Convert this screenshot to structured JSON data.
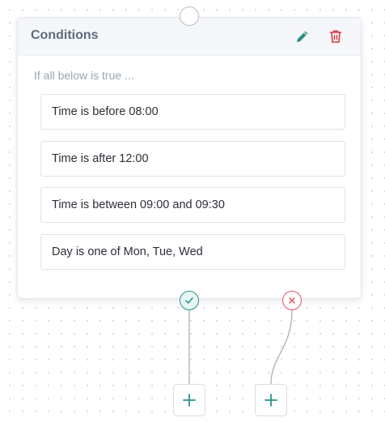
{
  "card": {
    "title": "Conditions",
    "subtitle": "If all below is true ...",
    "actions": [
      {
        "name": "edit",
        "icon": "pencil-icon",
        "color": "#2a8f88"
      },
      {
        "name": "delete",
        "icon": "trash-icon",
        "color": "#dc3545"
      }
    ],
    "conditions": [
      {
        "label": "Time is before 08:00"
      },
      {
        "label": "Time is after 12:00"
      },
      {
        "label": "Time is between 09:00 and 09:30"
      },
      {
        "label": "Day is one of Mon, Tue, Wed"
      }
    ]
  },
  "ports": {
    "input": {
      "icon": "input-port-circle"
    },
    "true_branch": {
      "icon": "check-icon",
      "color": "#2a8f88"
    },
    "false_branch": {
      "icon": "x-icon",
      "color": "#e0555f"
    }
  },
  "add_buttons": [
    {
      "branch": "true",
      "icon": "plus-icon"
    },
    {
      "branch": "false",
      "icon": "plus-icon"
    }
  ],
  "colors": {
    "accent": "#2a8f88",
    "danger": "#dc3545",
    "connector": "#a9b0b9"
  }
}
